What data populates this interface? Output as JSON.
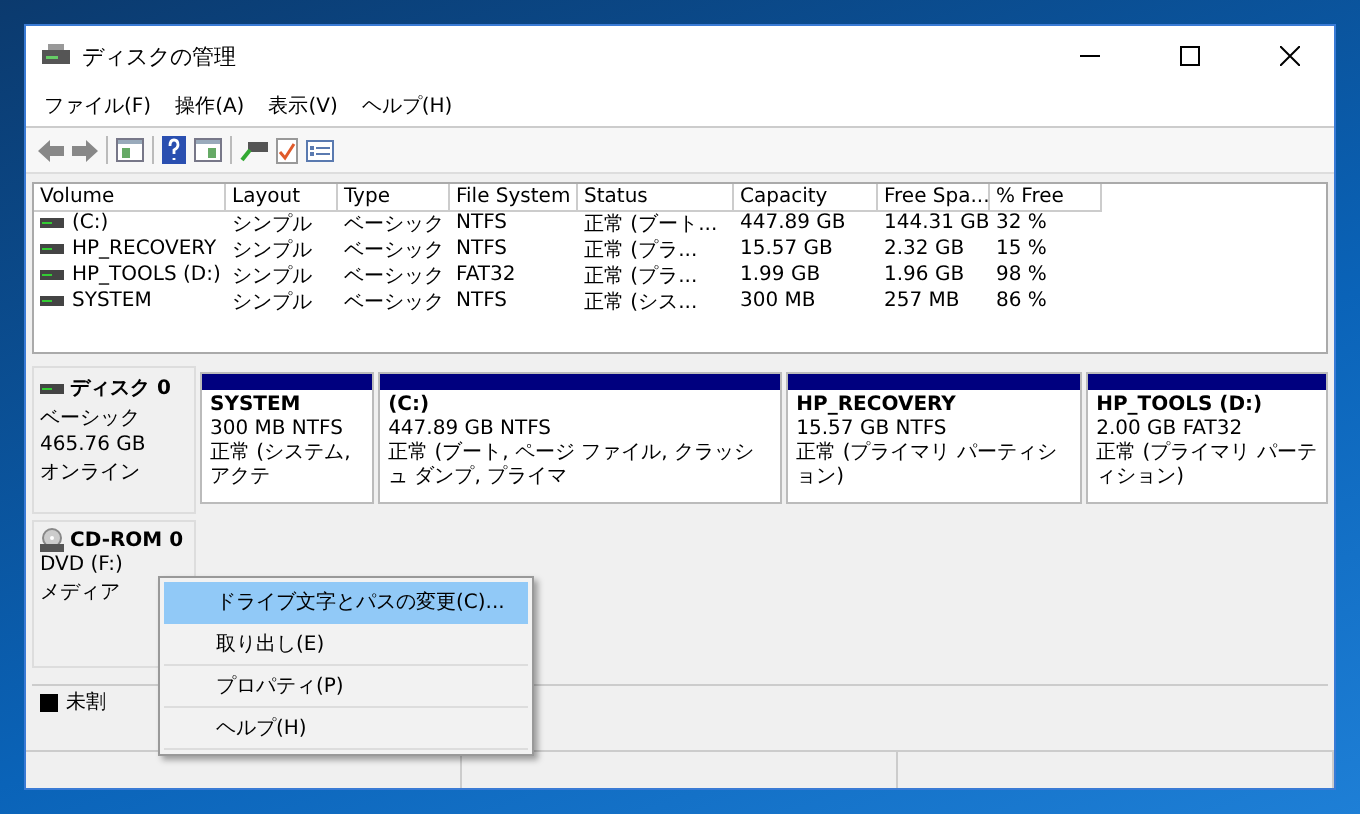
{
  "window": {
    "title": "ディスクの管理"
  },
  "menu": [
    "ファイル(F)",
    "操作(A)",
    "表示(V)",
    "ヘルプ(H)"
  ],
  "volumes": {
    "columns": [
      "Volume",
      "Layout",
      "Type",
      "File System",
      "Status",
      "Capacity",
      "Free Spa...",
      "% Free"
    ],
    "rows": [
      [
        "(C:)",
        "シンプル",
        "ベーシック",
        "NTFS",
        "正常 (ブート...",
        "447.89 GB",
        "144.31 GB",
        "32 %"
      ],
      [
        "HP_RECOVERY",
        "シンプル",
        "ベーシック",
        "NTFS",
        "正常 (プラ...",
        "15.57 GB",
        "2.32 GB",
        "15 %"
      ],
      [
        "HP_TOOLS (D:)",
        "シンプル",
        "ベーシック",
        "FAT32",
        "正常 (プラ...",
        "1.99 GB",
        "1.96 GB",
        "98 %"
      ],
      [
        "SYSTEM",
        "シンプル",
        "ベーシック",
        "NTFS",
        "正常 (シス...",
        "300 MB",
        "257 MB",
        "86 %"
      ]
    ]
  },
  "disks": [
    {
      "kind": "disk",
      "name": "ディスク 0",
      "lines": [
        "ベーシック",
        "465.76 GB",
        "オンライン"
      ],
      "partitions": [
        {
          "name": "SYSTEM",
          "size": "300 MB NTFS",
          "status": "正常 (システム, アクテ"
        },
        {
          "name": "(C:)",
          "size": "447.89 GB NTFS",
          "status": "正常 (ブート, ページ ファイル, クラッシュ ダンプ, プライマ"
        },
        {
          "name": "HP_RECOVERY",
          "size": "15.57 GB NTFS",
          "status": "正常 (プライマリ パーティション)"
        },
        {
          "name": "HP_TOOLS  (D:)",
          "size": "2.00 GB FAT32",
          "status": "正常 (プライマリ パーティション)"
        }
      ]
    },
    {
      "kind": "cdrom",
      "name": "CD-ROM 0",
      "lines": [
        "DVD (F:)",
        "メディア"
      ]
    }
  ],
  "legend": [
    {
      "label": "未割",
      "color": "#000000"
    }
  ],
  "context_menu": [
    {
      "label": "ドライブ文字とパスの変更(C)...",
      "selected": true
    },
    {
      "label": "取り出し(E)",
      "selected": false
    },
    {
      "label": "プロパティ(P)",
      "selected": false
    },
    {
      "label": "ヘルプ(H)",
      "selected": false
    }
  ]
}
